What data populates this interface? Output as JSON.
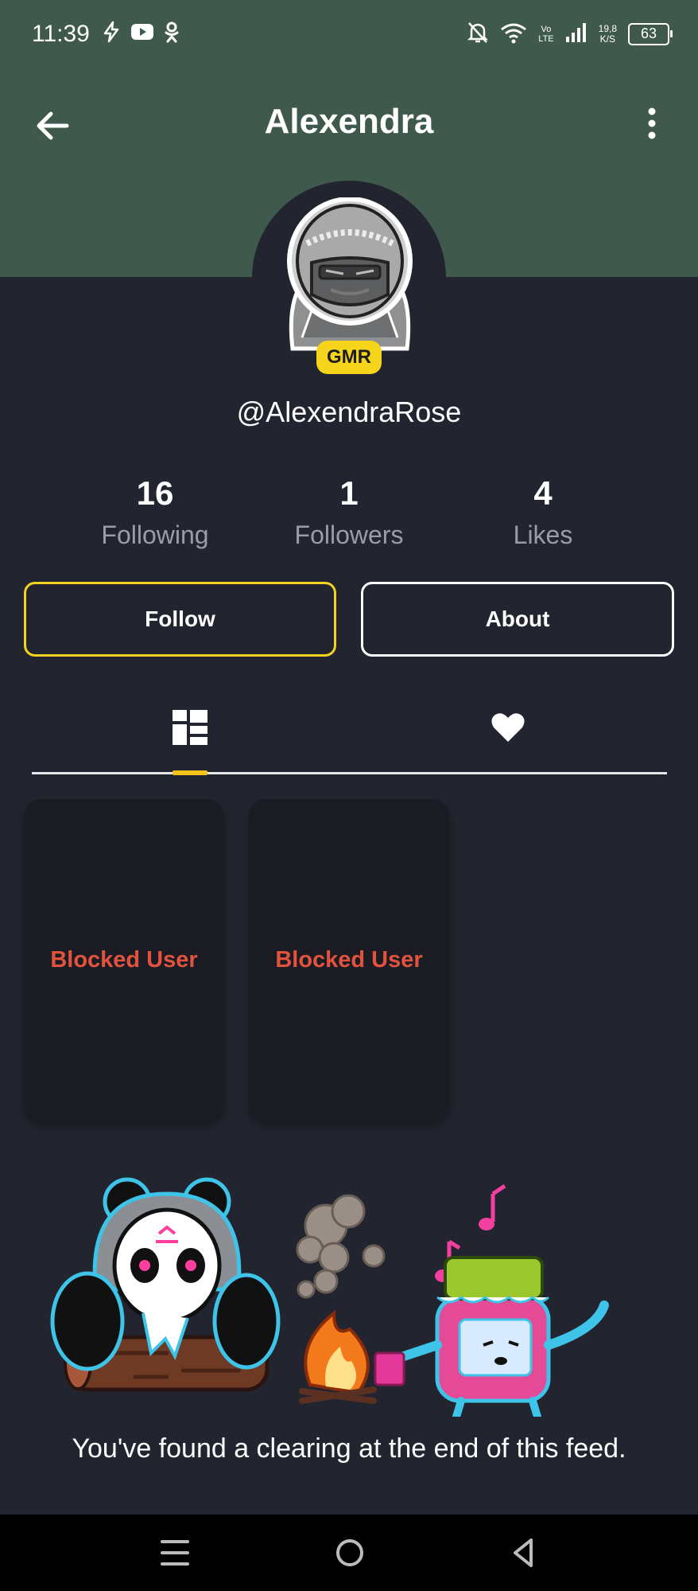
{
  "status_bar": {
    "time": "11:39",
    "volte_top": "Vo",
    "volte_bottom": "LTE",
    "net_speed_value": "19,8",
    "net_speed_unit": "K/S",
    "battery": "63"
  },
  "app_bar": {
    "title": "Alexendra"
  },
  "profile": {
    "badge": "GMR",
    "username": "@AlexendraRose"
  },
  "stats": [
    {
      "value": "16",
      "label": "Following"
    },
    {
      "value": "1",
      "label": "Followers"
    },
    {
      "value": "4",
      "label": "Likes"
    }
  ],
  "actions": {
    "follow_label": "Follow",
    "about_label": "About"
  },
  "tabs": [
    {
      "icon": "grid-icon",
      "selected": true
    },
    {
      "icon": "heart-icon",
      "selected": false
    }
  ],
  "posts": [
    {
      "label": "Blocked User"
    },
    {
      "label": "Blocked User"
    }
  ],
  "feed_end": {
    "message": "You've found a clearing at the end of this feed."
  },
  "colors": {
    "header": "#3f5a4c",
    "background": "#22252f",
    "accent_yellow": "#f3d31f",
    "blocked_red": "#e2533e"
  }
}
